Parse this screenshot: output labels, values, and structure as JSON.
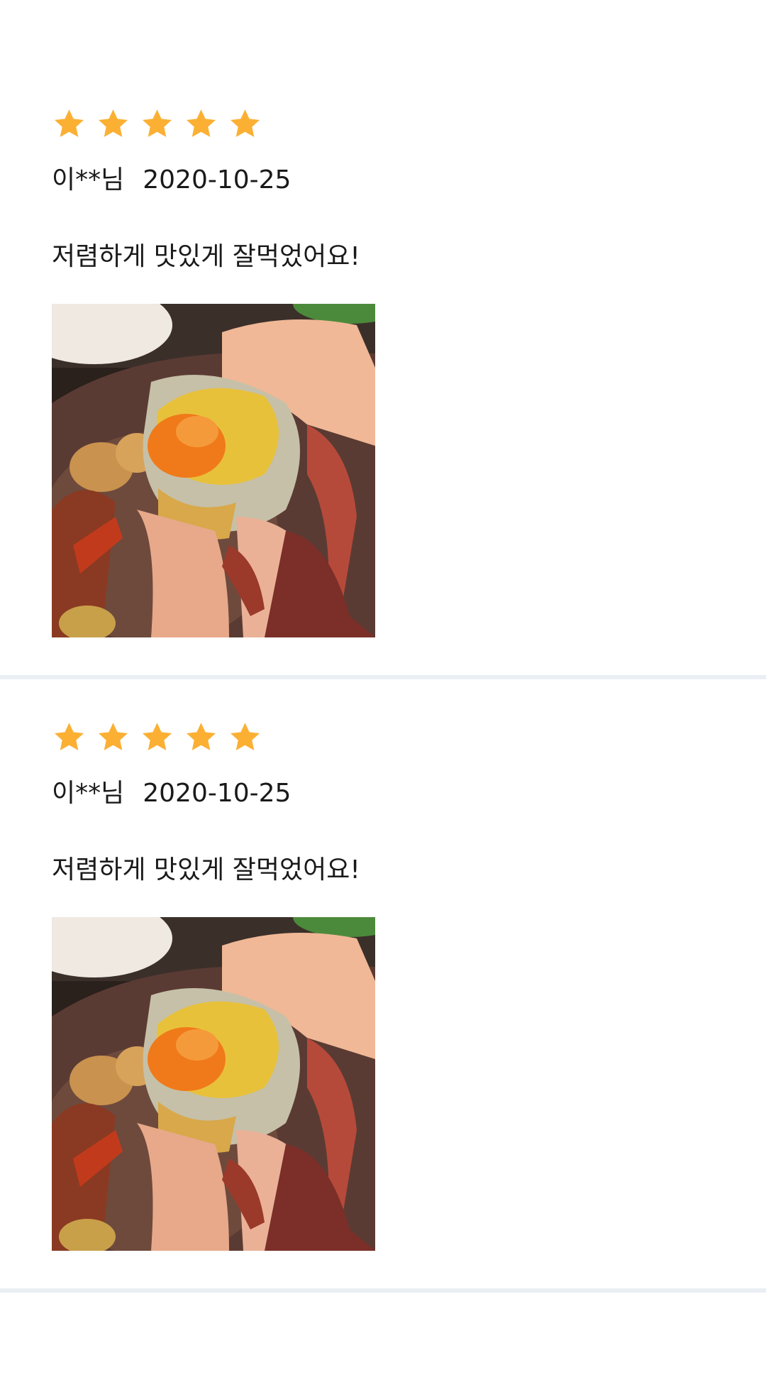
{
  "star_color": "#fbb034",
  "divider_color": "#e9eff4",
  "reviews": [
    {
      "rating": 5,
      "author": "이**님",
      "date": "2020-10-25",
      "content": "저렴하게 맛있게 잘먹었어요!",
      "photo_alt": "간장게장 사진"
    },
    {
      "rating": 5,
      "author": "이**님",
      "date": "2020-10-25",
      "content": "저렴하게 맛있게 잘먹었어요!",
      "photo_alt": "간장게장 사진"
    }
  ]
}
